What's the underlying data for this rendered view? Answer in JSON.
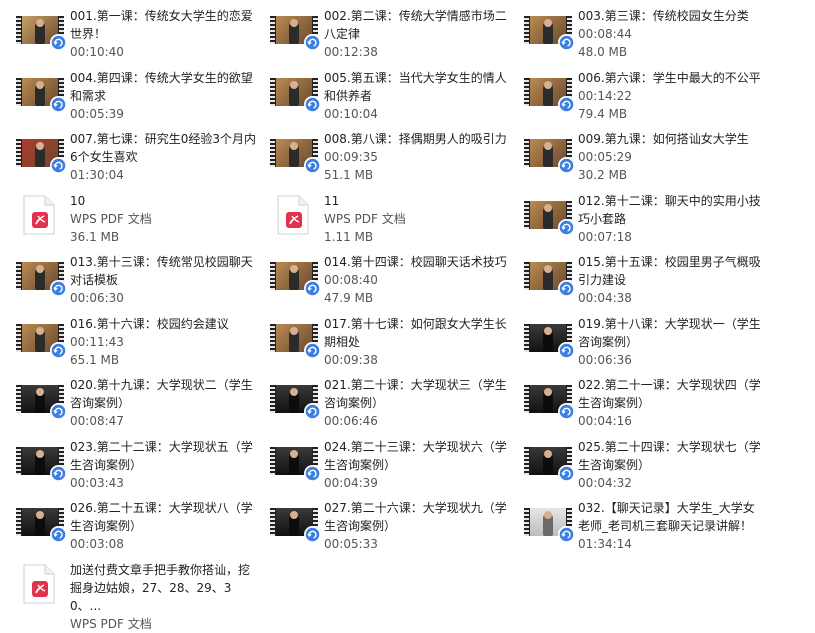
{
  "files": [
    {
      "name": "001.第一课：传统女大学生的恋爱世界！",
      "meta": [
        "00:10:40"
      ],
      "type": "video",
      "theme": "first"
    },
    {
      "name": "002.第二课：传统大学情感市场二八定律",
      "meta": [
        "00:12:38"
      ],
      "type": "video",
      "theme": "warm"
    },
    {
      "name": "003.第三课：传统校园女生分类",
      "meta": [
        "00:08:44",
        "48.0 MB"
      ],
      "type": "video",
      "theme": "warm"
    },
    {
      "name": "004.第四课：传统大学女生的欲望和需求",
      "meta": [
        "00:05:39"
      ],
      "type": "video",
      "theme": "warm"
    },
    {
      "name": "005.第五课：当代大学女生的情人和供养者",
      "meta": [
        "00:10:04"
      ],
      "type": "video",
      "theme": "warm"
    },
    {
      "name": "006.第六课：学生中最大的不公平",
      "meta": [
        "00:14:22",
        "79.4 MB"
      ],
      "type": "video",
      "theme": "warm"
    },
    {
      "name": "007.第七课：研究生0经验3个月内6个女生喜欢",
      "meta": [
        "01:30:04"
      ],
      "type": "video",
      "theme": "red"
    },
    {
      "name": "008.第八课：择偶期男人的吸引力",
      "meta": [
        "00:09:35",
        "51.1 MB"
      ],
      "type": "video",
      "theme": "warm"
    },
    {
      "name": "009.第九课：如何搭讪女大学生",
      "meta": [
        "00:05:29",
        "30.2 MB"
      ],
      "type": "video",
      "theme": "warm"
    },
    {
      "name": "10",
      "meta": [
        "WPS PDF 文档",
        "36.1 MB"
      ],
      "type": "pdf"
    },
    {
      "name": "11",
      "meta": [
        "WPS PDF 文档",
        "1.11 MB"
      ],
      "type": "pdf"
    },
    {
      "name": "012.第十二课：聊天中的实用小技巧小套路",
      "meta": [
        "00:07:18"
      ],
      "type": "video",
      "theme": "warm"
    },
    {
      "name": "013.第十三课：传统常见校园聊天对话模板",
      "meta": [
        "00:06:30"
      ],
      "type": "video",
      "theme": "warm"
    },
    {
      "name": "014.第十四课：校园聊天话术技巧",
      "meta": [
        "00:08:40",
        "47.9 MB"
      ],
      "type": "video",
      "theme": "warm"
    },
    {
      "name": "015.第十五课：校园里男子气概吸引力建设",
      "meta": [
        "00:04:38"
      ],
      "type": "video",
      "theme": "warm"
    },
    {
      "name": "016.第十六课：校园约会建议",
      "meta": [
        "00:11:43",
        "65.1 MB"
      ],
      "type": "video",
      "theme": "warm"
    },
    {
      "name": "017.第十七课：如何跟女大学生长期相处",
      "meta": [
        "00:09:38"
      ],
      "type": "video",
      "theme": "warm"
    },
    {
      "name": "019.第十八课：大学现状一（学生咨询案例）",
      "meta": [
        "00:06:36"
      ],
      "type": "video",
      "theme": "dark"
    },
    {
      "name": "020.第十九课：大学现状二（学生咨询案例）",
      "meta": [
        "00:08:47"
      ],
      "type": "video",
      "theme": "dark"
    },
    {
      "name": "021.第二十课：大学现状三（学生咨询案例）",
      "meta": [
        "00:06:46"
      ],
      "type": "video",
      "theme": "dark"
    },
    {
      "name": "022.第二十一课：大学现状四（学生咨询案例）",
      "meta": [
        "00:04:16"
      ],
      "type": "video",
      "theme": "dark"
    },
    {
      "name": "023.第二十二课：大学现状五（学生咨询案例）",
      "meta": [
        "00:03:43"
      ],
      "type": "video",
      "theme": "dark"
    },
    {
      "name": "024.第二十三课：大学现状六（学生咨询案例）",
      "meta": [
        "00:04:39"
      ],
      "type": "video",
      "theme": "dark"
    },
    {
      "name": "025.第二十四课：大学现状七（学生咨询案例）",
      "meta": [
        "00:04:32"
      ],
      "type": "video",
      "theme": "dark"
    },
    {
      "name": "026.第二十五课：大学现状八（学生咨询案例）",
      "meta": [
        "00:03:08"
      ],
      "type": "video",
      "theme": "dark"
    },
    {
      "name": "027.第二十六课：大学现状九（学生咨询案例）",
      "meta": [
        "00:05:33"
      ],
      "type": "video",
      "theme": "dark"
    },
    {
      "name": "032.【聊天记录】大学生_大学女老师_老司机三套聊天记录讲解！",
      "meta": [
        "01:34:14"
      ],
      "type": "video",
      "theme": "light"
    },
    {
      "name": "加送付费文章手把手教你搭讪，挖掘身边姑娘，27、28、29、30、...",
      "meta": [
        "WPS PDF 文档"
      ],
      "type": "pdf"
    }
  ],
  "colors": {
    "badge_blue": "#3d7fe0",
    "pdf_red": "#e2324e",
    "theme_warm": "#b98a52",
    "theme_dark": "#2a2a2a",
    "theme_red": "#b03a2e",
    "theme_light": "#d9d9d9",
    "theme_first": "#c7a465"
  }
}
